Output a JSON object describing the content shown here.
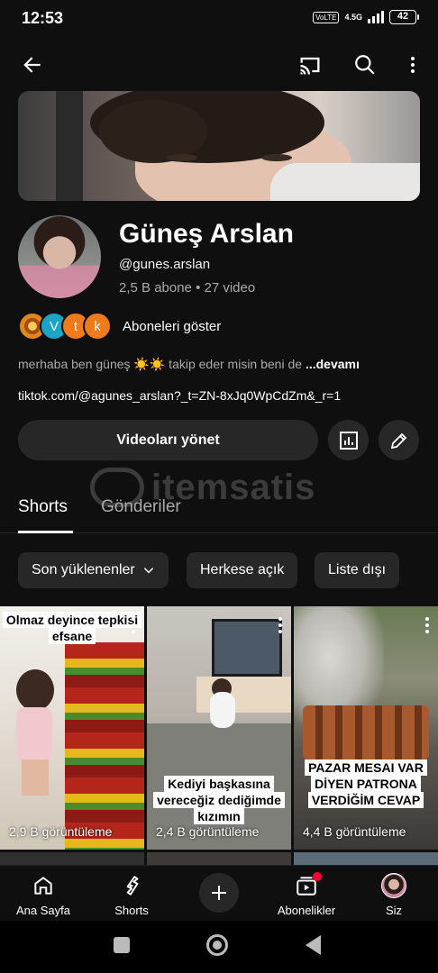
{
  "status_bar": {
    "time": "12:53",
    "volte": "VoLTE",
    "network": "4.5G",
    "battery": "42"
  },
  "channel": {
    "name": "Güneş Arslan",
    "handle": "@gunes.arslan",
    "stats": "2,5 B abone • 27 video",
    "subscriber_bubbles": [
      "",
      "V",
      "t",
      "k"
    ],
    "show_subscribers": "Aboneleri göster",
    "bio": "merhaba ben güneş ☀️☀️ takip eder misin beni de ",
    "bio_more": "...devamı",
    "link": "tiktok.com/@agunes_arslan?_t=ZN-8xJq0WpCdZm&_r=1",
    "manage_videos": "Videoları yönet"
  },
  "watermark": {
    "text": "itemsatis"
  },
  "tabs": [
    {
      "label": "Shorts",
      "active": true
    },
    {
      "label": "Gönderiler",
      "active": false
    }
  ],
  "chips": [
    {
      "label": "Son yüklenenler"
    },
    {
      "label": "Herkese açık"
    },
    {
      "label": "Liste dışı"
    }
  ],
  "shorts": [
    {
      "caption": "Olmaz deyince tepkisi efsane",
      "views": "2,9 B görüntüleme"
    },
    {
      "caption": "Kediyi başkasına vereceğiz dediğimde kızımın",
      "views": "2,4 B görüntüleme"
    },
    {
      "caption": "PAZAR MESAI VAR DİYEN PATRONA VERDİĞİM CEVAP",
      "views": "4,4 B görüntüleme"
    }
  ],
  "bottom_nav": [
    {
      "label": "Ana Sayfa"
    },
    {
      "label": "Shorts"
    },
    {
      "label": ""
    },
    {
      "label": "Abonelikler"
    },
    {
      "label": "Siz"
    }
  ],
  "colors": {
    "background": "#0f0f0f",
    "surface": "#272727",
    "secondary_text": "#aaaaaa",
    "accent_red": "#ff0033",
    "bubble_orange": "#f07b1d",
    "bubble_teal": "#1ba4c4"
  },
  "icons": [
    "back-arrow-icon",
    "cast-icon",
    "search-icon",
    "more-vert-icon",
    "analytics-icon",
    "edit-pencil-icon",
    "chevron-down-icon",
    "home-icon",
    "shorts-icon",
    "plus-icon",
    "subscriptions-icon"
  ]
}
